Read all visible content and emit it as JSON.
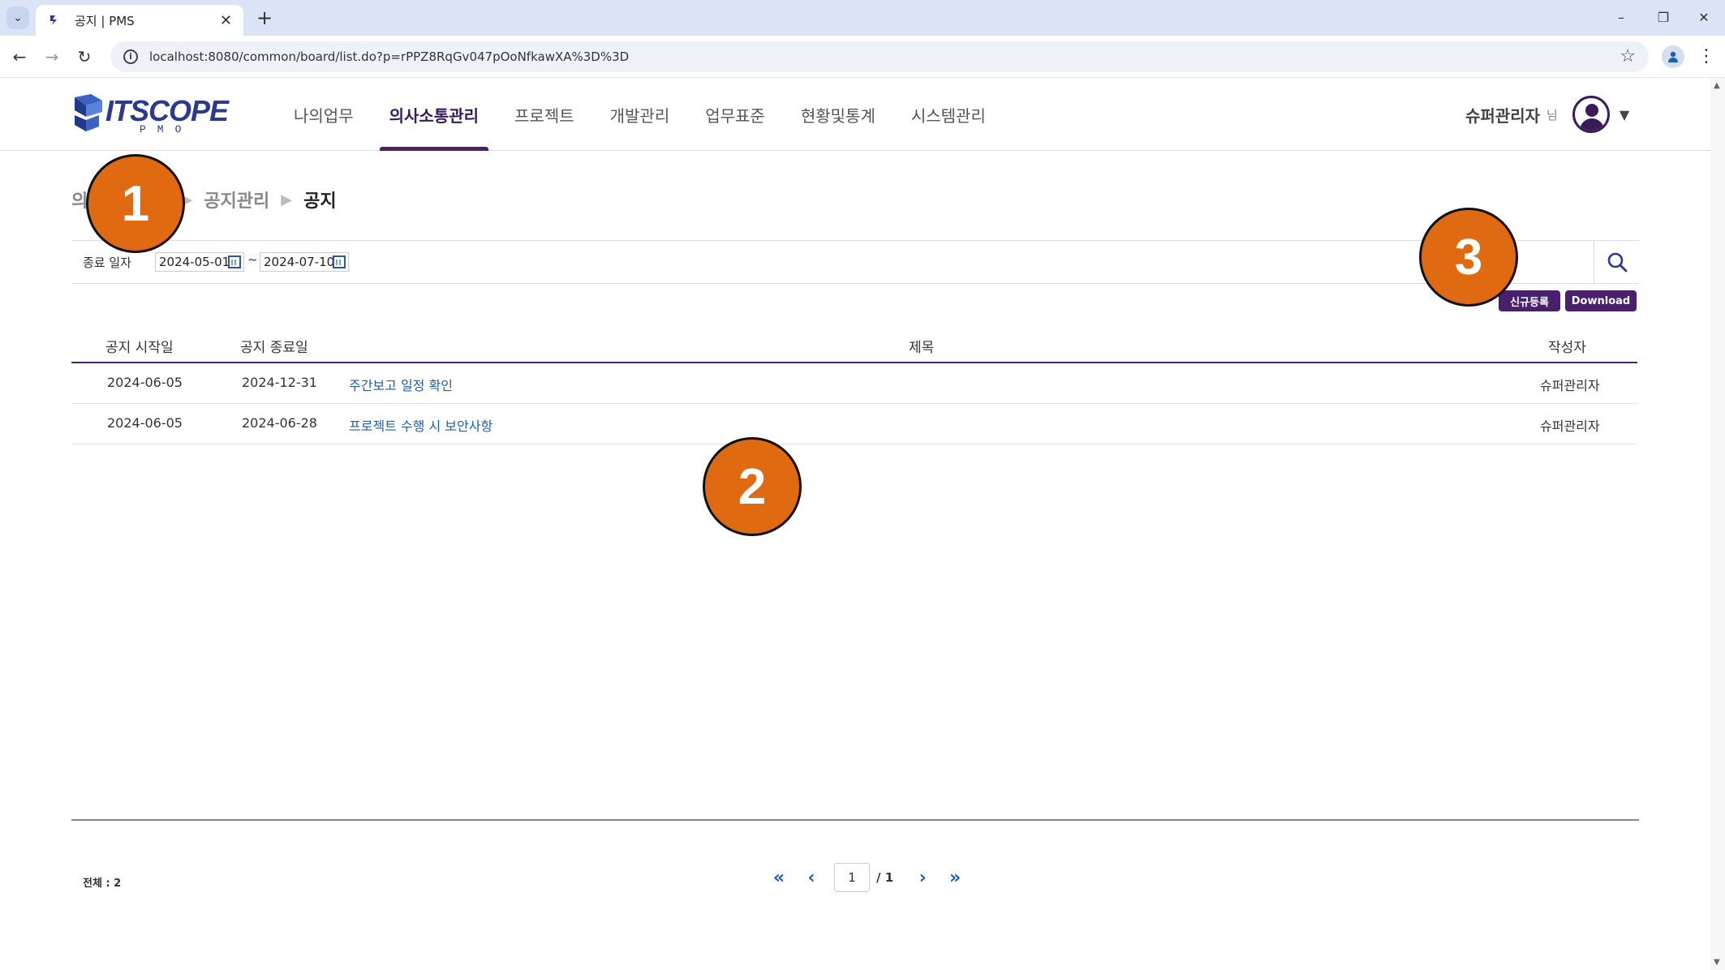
{
  "browser": {
    "tab_title": "공지 | PMS",
    "url": "localhost:8080/common/board/list.do?p=rPPZ8RqGv047pOoNfkawXA%3D%3D",
    "new_tab": "+",
    "minimize": "–",
    "restore": "❐",
    "close": "✕"
  },
  "header": {
    "logo_text": "ITSCOPE",
    "logo_sub": "PMO",
    "nav": [
      "나의업무",
      "의사소통관리",
      "프로젝트",
      "개발관리",
      "업무표준",
      "현황및통계",
      "시스템관리"
    ],
    "active_nav": "의사소통관리",
    "user_name": "슈퍼관리자",
    "user_suffix": "님"
  },
  "breadcrumb": {
    "items": [
      "의사소통관리",
      "공지관리"
    ],
    "current": "공지"
  },
  "search": {
    "label": "종료 일자",
    "date_from": "2024-05-01",
    "date_to": "2024-07-10",
    "separator": "~"
  },
  "actions": {
    "new_label": "신규등록",
    "download_label": "Download"
  },
  "table": {
    "columns": [
      "공지 시작일",
      "공지 종료일",
      "제목",
      "작성자"
    ],
    "rows": [
      {
        "start": "2024-06-05",
        "end": "2024-12-31",
        "title": "주간보고 일정 확인",
        "author": "슈퍼관리자"
      },
      {
        "start": "2024-06-05",
        "end": "2024-06-28",
        "title": "프로젝트 수행 시 보안사항",
        "author": "슈퍼관리자"
      }
    ]
  },
  "footer": {
    "total": "전체 : 2",
    "page_current": "1",
    "page_total": "/ 1"
  },
  "annotations": [
    "1",
    "2",
    "3"
  ],
  "colors": {
    "brand": "#4a1f6e",
    "link": "#1a5fb4",
    "annotation": "#e06a12"
  }
}
